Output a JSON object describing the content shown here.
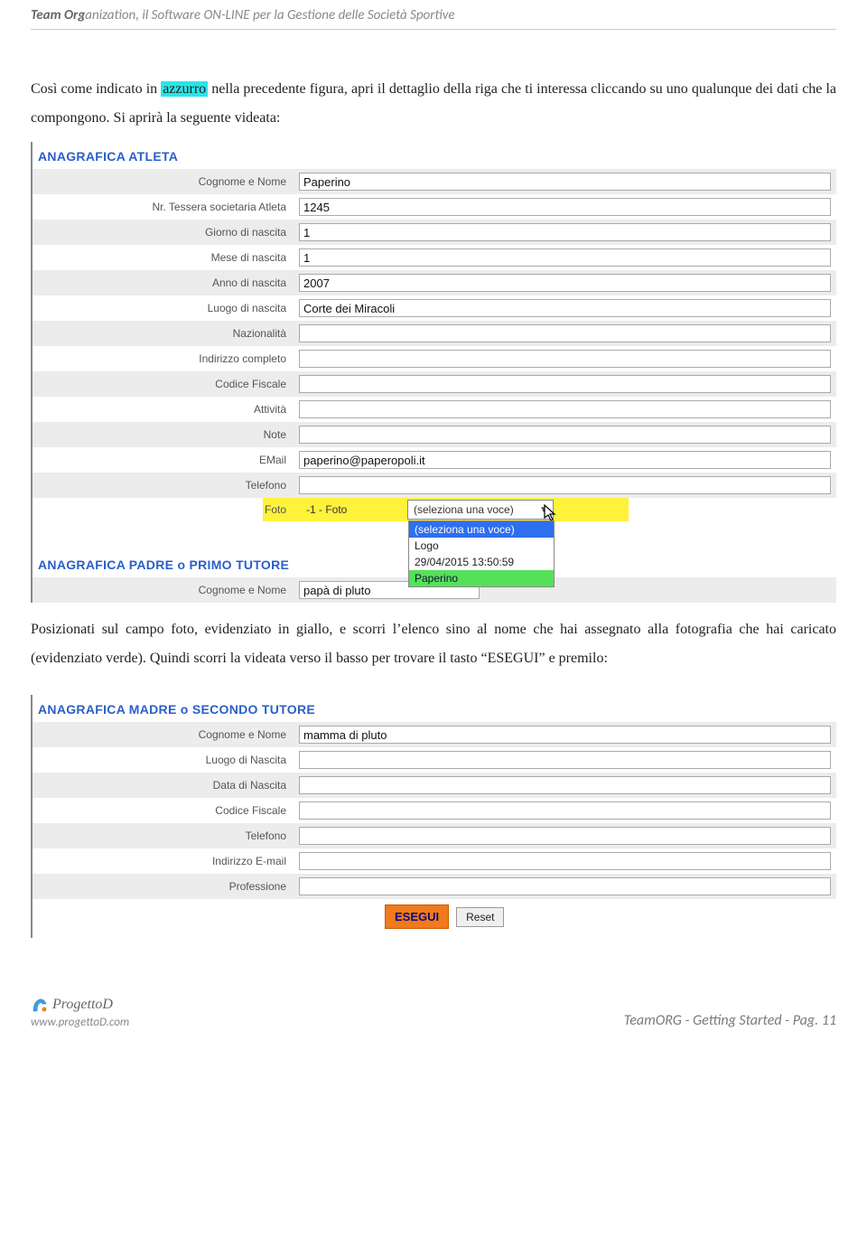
{
  "header": {
    "bold": "Team Org",
    "rest": "anization, il Software ON-LINE per la Gestione delle Società Sportive"
  },
  "para1_a": "Così come indicato in ",
  "para1_hl": "azzurro",
  "para1_b": " nella precedente figura, apri il dettaglio della riga che ti interessa cliccando su uno qualunque dei dati che la compongono. Si aprirà la seguente videata:",
  "form1": {
    "title": "ANAGRAFICA ATLETA",
    "rows": [
      {
        "label": "Cognome e Nome",
        "value": "Paperino"
      },
      {
        "label": "Nr. Tessera societaria Atleta",
        "value": "1245"
      },
      {
        "label": "Giorno di nascita",
        "value": "1"
      },
      {
        "label": "Mese di nascita",
        "value": "1"
      },
      {
        "label": "Anno di nascita",
        "value": "2007"
      },
      {
        "label": "Luogo di nascita",
        "value": "Corte dei Miracoli"
      },
      {
        "label": "Nazionalità",
        "value": ""
      },
      {
        "label": "Indirizzo completo",
        "value": ""
      },
      {
        "label": "Codice Fiscale",
        "value": ""
      },
      {
        "label": "Attività",
        "value": ""
      },
      {
        "label": "Note",
        "value": ""
      },
      {
        "label": "EMail",
        "value": "paperino@paperopoli.it"
      },
      {
        "label": "Telefono",
        "value": ""
      }
    ],
    "foto_label": "Foto",
    "foto_sub": "-1  -  Foto",
    "foto_selected": "(seleziona una voce)",
    "foto_options": [
      {
        "text": "(seleziona una voce)",
        "cls": "sel-blue"
      },
      {
        "text": "Logo",
        "cls": ""
      },
      {
        "text": "29/04/2015 13:50:59",
        "cls": ""
      },
      {
        "text": "Paperino",
        "cls": "sel-green"
      }
    ]
  },
  "form1b": {
    "title_a": "ANAGRAFICA PADRE ",
    "title_o": "o",
    "title_b": " PRIMO TUTORE",
    "row_label": "Cognome e Nome",
    "row_value": "papà di pluto"
  },
  "para2": "Posizionati sul campo foto, evidenziato in giallo, e scorri l’elenco sino al nome che hai assegnato alla fotografia che hai caricato (evidenziato verde). Quindi scorri la videata verso il basso per trovare il tasto “ESEGUI” e premilo:",
  "form2": {
    "title_a": "ANAGRAFICA MADRE ",
    "title_o": "o",
    "title_b": " SECONDO TUTORE",
    "rows": [
      {
        "label": "Cognome e Nome",
        "value": "mamma di pluto"
      },
      {
        "label": "Luogo di Nascita",
        "value": ""
      },
      {
        "label": "Data di Nascita",
        "value": ""
      },
      {
        "label": "Codice Fiscale",
        "value": ""
      },
      {
        "label": "Telefono",
        "value": ""
      },
      {
        "label": "Indirizzo E-mail",
        "value": ""
      },
      {
        "label": "Professione",
        "value": ""
      }
    ],
    "esegui": "ESEGUI",
    "reset": "Reset"
  },
  "footer": {
    "right": "TeamORG -  Getting Started  - Pag. 11",
    "brand": "ProgettoD",
    "url": "www.progettoD.com"
  }
}
